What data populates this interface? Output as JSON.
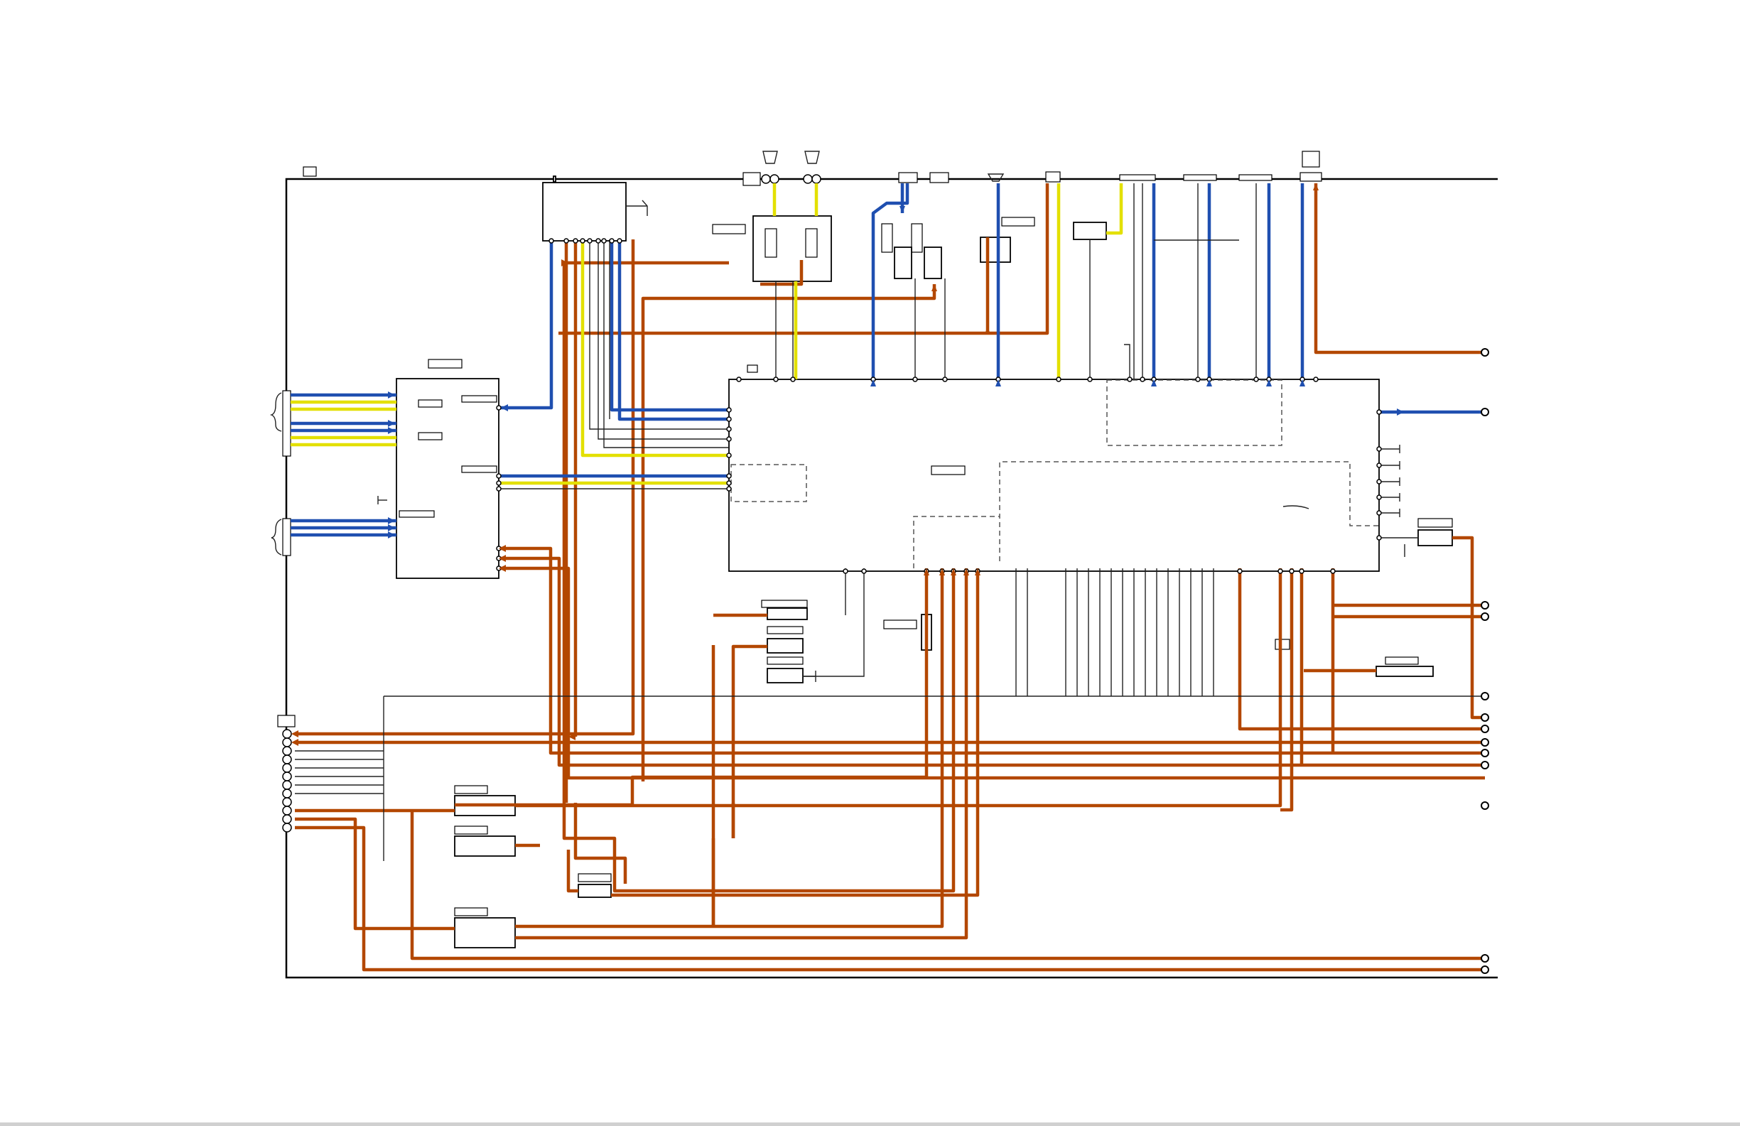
{
  "diagram": {
    "kind": "wiring-schematic",
    "colors": {
      "power_line": "#b34700",
      "signal_line": "#1f4fb0",
      "video_line": "#e3e000",
      "frame": "#000000"
    },
    "blocks": [
      {
        "id": "main-ic",
        "label": ""
      },
      {
        "id": "input-switch-ic",
        "label": ""
      },
      {
        "id": "tuner-module",
        "label": ""
      },
      {
        "id": "rear-jack-panel",
        "label": ""
      }
    ],
    "connectors": [
      {
        "id": "rca-pair-1"
      },
      {
        "id": "rca-pair-2"
      },
      {
        "id": "multi-pin-1"
      },
      {
        "id": "multi-pin-2"
      },
      {
        "id": "hdmi-port"
      },
      {
        "id": "usb-port"
      }
    ]
  }
}
